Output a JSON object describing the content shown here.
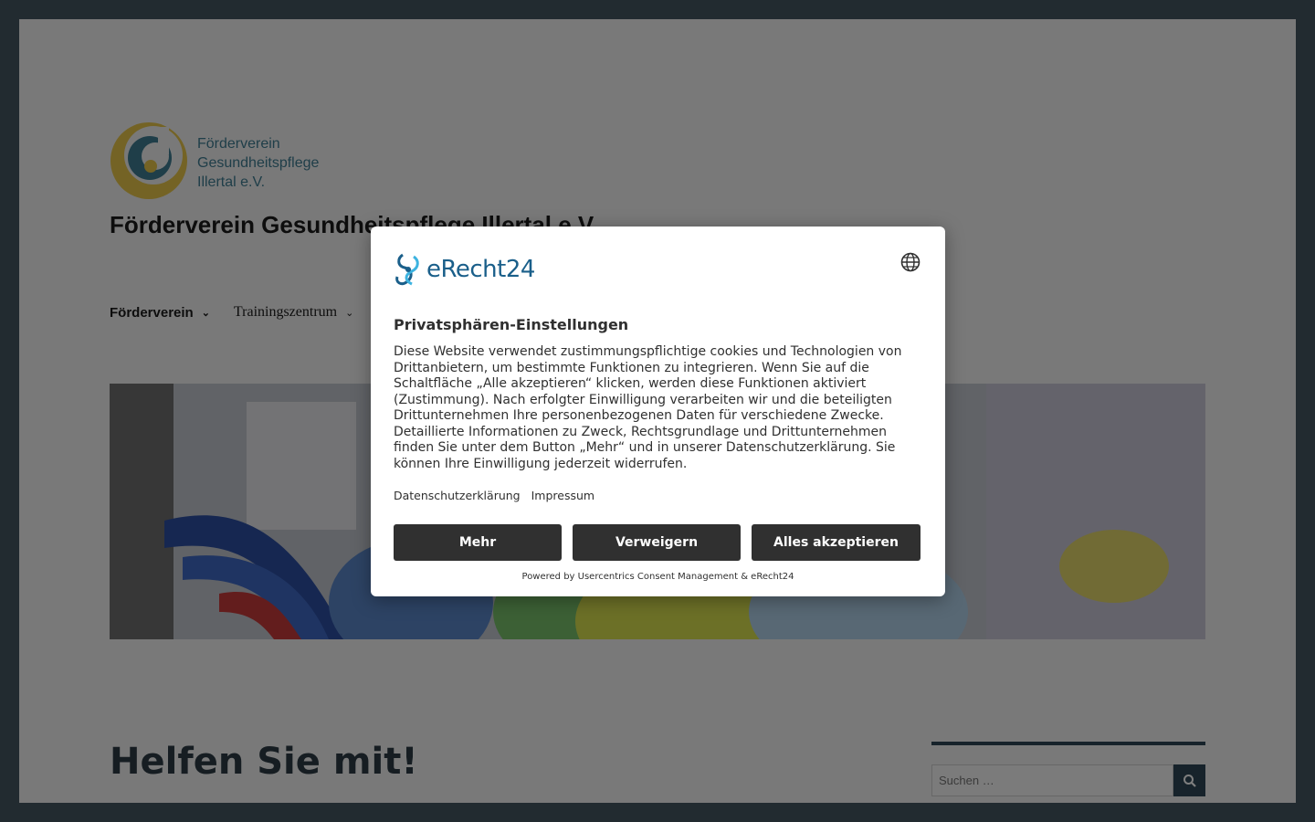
{
  "site": {
    "logo_lines": [
      "Förderverein",
      "Gesundheitspflege",
      "Illertal e.V."
    ],
    "title": "Förderverein Gesundheitspflege Illertal e.V.",
    "nav": [
      {
        "label": "Förderverein"
      },
      {
        "label": "Trainingszentrum"
      }
    ],
    "page_heading": "Helfen Sie mit!",
    "search_placeholder": "Suchen …"
  },
  "consent": {
    "brand": "eRecht24",
    "title": "Privatsphären-Einstellungen",
    "body": "Diese Website verwendet zustimmungspflichtige cookies und Technologien von Drittanbietern, um bestimmte Funktionen zu integrieren. Wenn Sie auf die Schaltfläche „Alle akzeptieren“ klicken, werden diese Funktionen aktiviert (Zustimmung). Nach erfolgter Einwilligung verarbeiten wir und die beteiligten Drittunternehmen Ihre personenbezogenen Daten für verschiedene Zwecke. Detaillierte Informationen zu Zweck, Rechtsgrundlage und Drittunternehmen finden Sie unter dem Button „Mehr“ und in unserer Datenschutzerklärung. Sie können Ihre Einwilligung jederzeit widerrufen.",
    "links": {
      "privacy": "Datenschutzerklärung",
      "imprint": "Impressum"
    },
    "buttons": {
      "more": "Mehr",
      "deny": "Verweigern",
      "accept_all": "Alles akzeptieren"
    },
    "powered_by": "Powered by Usercentrics Consent Management & eRecht24"
  },
  "colors": {
    "frame": "#445760",
    "button_dark": "#303030",
    "brand_blue": "#1a5f8a",
    "logo_gold": "#e8c64a",
    "accent_dark": "#2e4756"
  }
}
